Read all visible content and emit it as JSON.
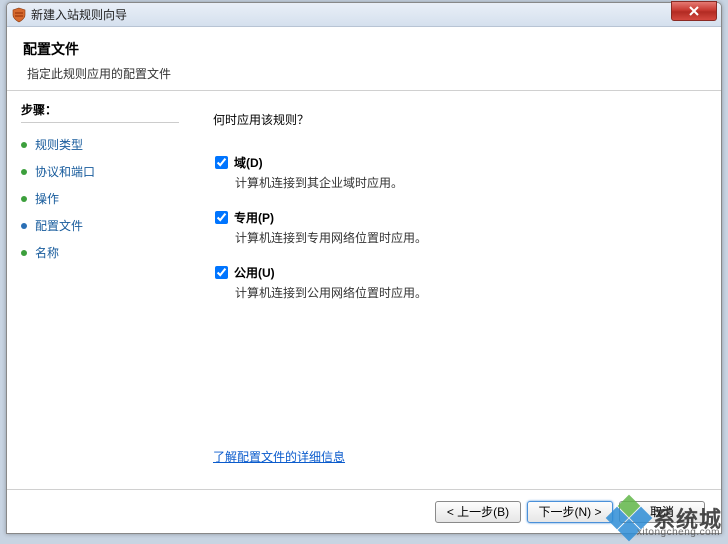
{
  "window": {
    "title": "新建入站规则向导"
  },
  "header": {
    "title": "配置文件",
    "subtitle": "指定此规则应用的配置文件"
  },
  "sidebar": {
    "heading": "步骤：",
    "items": [
      {
        "label": "规则类型"
      },
      {
        "label": "协议和端口"
      },
      {
        "label": "操作"
      },
      {
        "label": "配置文件"
      },
      {
        "label": "名称"
      }
    ]
  },
  "content": {
    "question": "何时应用该规则？",
    "checkboxes": [
      {
        "label": "域(D)",
        "desc": "计算机连接到其企业域时应用。",
        "checked": true
      },
      {
        "label": "专用(P)",
        "desc": "计算机连接到专用网络位置时应用。",
        "checked": true
      },
      {
        "label": "公用(U)",
        "desc": "计算机连接到公用网络位置时应用。",
        "checked": true
      }
    ],
    "learn_link": "了解配置文件的详细信息"
  },
  "buttons": {
    "back": "< 上一步(B)",
    "next": "下一步(N) >",
    "cancel": "取消"
  },
  "watermark": {
    "text": "系统城",
    "url": "xitongcheng.com"
  }
}
